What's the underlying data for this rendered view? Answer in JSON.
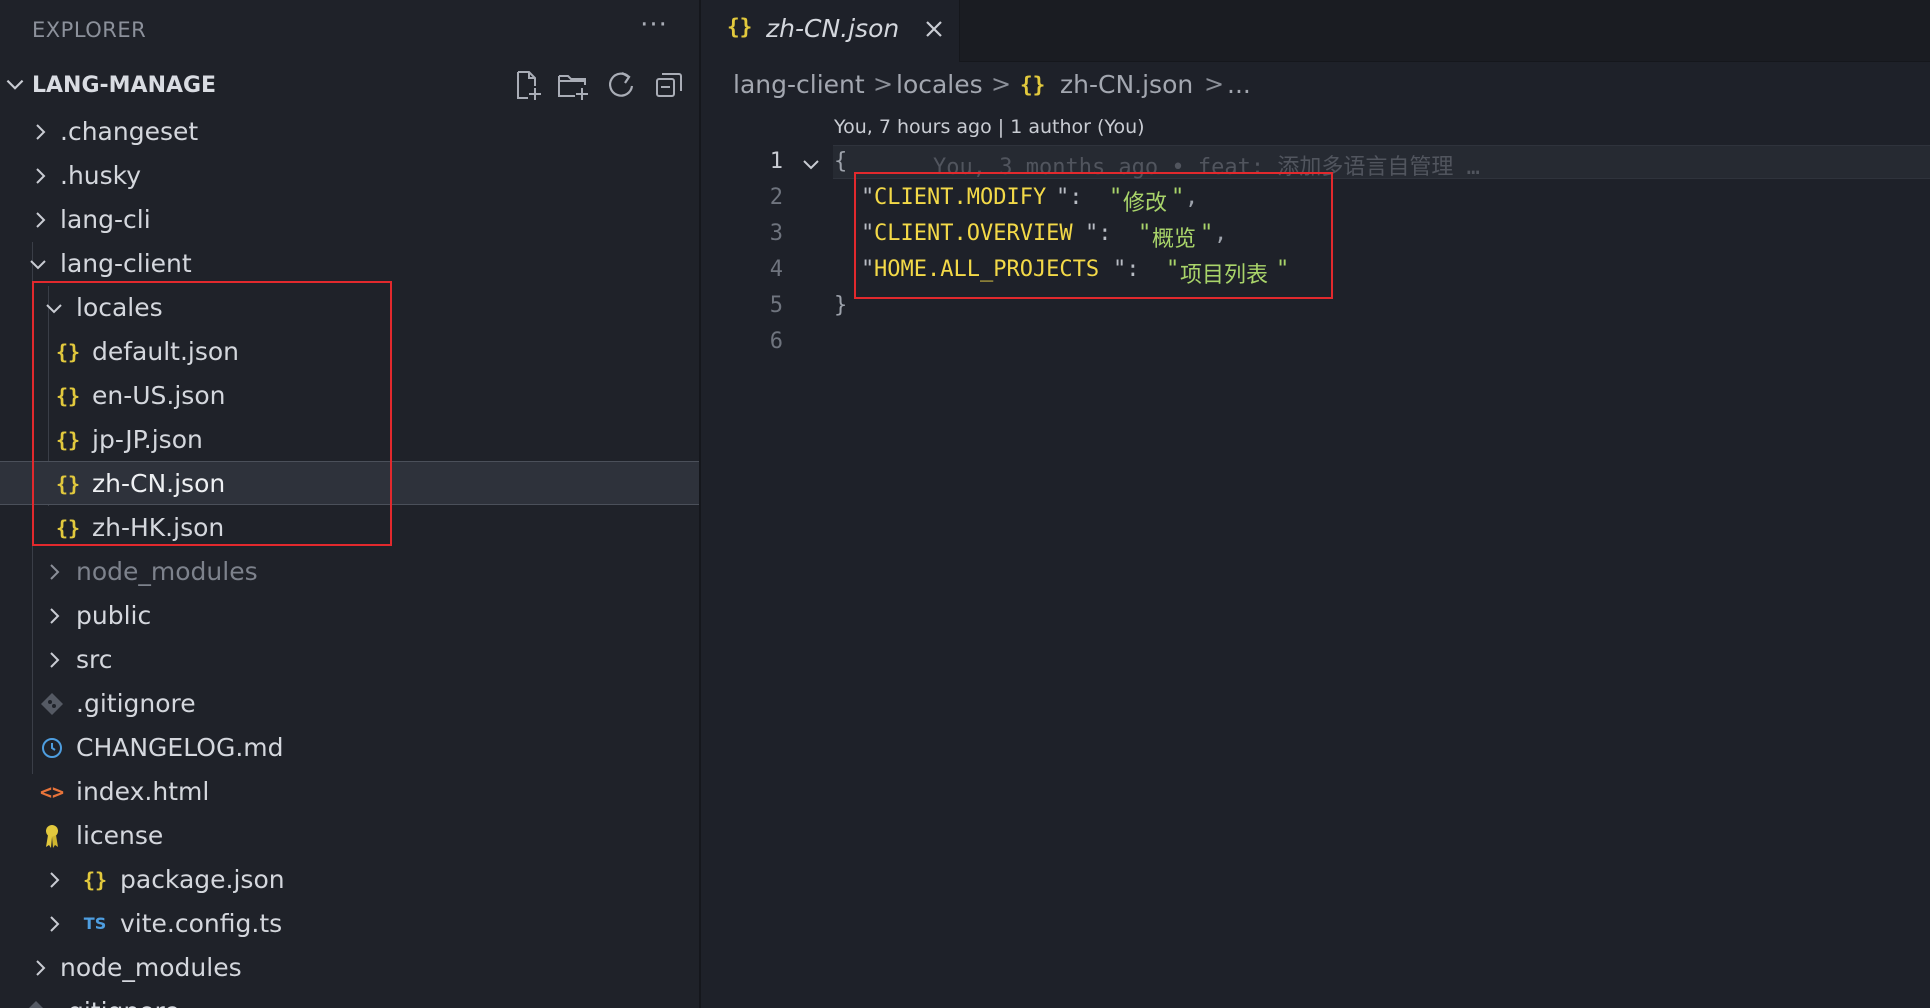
{
  "explorer": {
    "title": "EXPLORER",
    "more_label": "···",
    "project": "LANG-MANAGE",
    "toolbar": [
      "new-file-icon",
      "new-folder-icon",
      "refresh-icon",
      "collapse-all-icon"
    ]
  },
  "tree": [
    {
      "label": ".changeset",
      "kind": "folder",
      "expanded": false
    },
    {
      "label": ".husky",
      "kind": "folder",
      "expanded": false
    },
    {
      "label": "lang-cli",
      "kind": "folder",
      "expanded": false
    },
    {
      "label": "lang-client",
      "kind": "folder",
      "expanded": true
    },
    {
      "label": "locales",
      "kind": "folder",
      "expanded": true
    },
    {
      "label": "default.json",
      "kind": "json",
      "icon": "{}"
    },
    {
      "label": "en-US.json",
      "kind": "json",
      "icon": "{}"
    },
    {
      "label": "jp-JP.json",
      "kind": "json",
      "icon": "{}"
    },
    {
      "label": "zh-CN.json",
      "kind": "json",
      "icon": "{}",
      "selected": true
    },
    {
      "label": "zh-HK.json",
      "kind": "json",
      "icon": "{}"
    },
    {
      "label": "node_modules",
      "kind": "folder",
      "expanded": false,
      "dimmed": true
    },
    {
      "label": "public",
      "kind": "folder",
      "expanded": false
    },
    {
      "label": "src",
      "kind": "folder",
      "expanded": false
    },
    {
      "label": ".gitignore",
      "kind": "git"
    },
    {
      "label": "CHANGELOG.md",
      "kind": "changelog"
    },
    {
      "label": "index.html",
      "kind": "html",
      "icon": "<>"
    },
    {
      "label": "license",
      "kind": "license"
    },
    {
      "label": "package.json",
      "kind": "json",
      "icon": "{}"
    },
    {
      "label": "vite.config.ts",
      "kind": "ts",
      "icon": "TS"
    },
    {
      "label": "node_modules",
      "kind": "folder",
      "expanded": false
    },
    {
      "label": ".gitignore",
      "kind": "git"
    }
  ],
  "editor": {
    "tab": {
      "icon": "{}",
      "label": "zh-CN.json"
    },
    "breadcrumb": {
      "parts": [
        "lang-client",
        "locales",
        "zh-CN.json",
        "..."
      ],
      "separator": ">",
      "json_icon": "{}"
    },
    "blame_header": "You, 7 hours ago | 1 author (You)",
    "inline_blame": "You, 3 months ago • feat: 添加多语言自管理 …",
    "lines": [
      {
        "number": "1",
        "open": "{"
      },
      {
        "number": "2",
        "key": "CLIENT.MODIFY",
        "value": "修改",
        "trail": ","
      },
      {
        "number": "3",
        "key": "CLIENT.OVERVIEW",
        "value": "概览",
        "trail": ","
      },
      {
        "number": "4",
        "key": "HOME.ALL_PROJECTS",
        "value": "项目列表",
        "trail": ""
      },
      {
        "number": "5",
        "close": "}"
      },
      {
        "number": "6"
      }
    ]
  },
  "colors": {
    "json_icon": "#e2c93d",
    "highlight_box": "#e2292d",
    "key": "#f3d948",
    "string": "#a9d46a"
  }
}
